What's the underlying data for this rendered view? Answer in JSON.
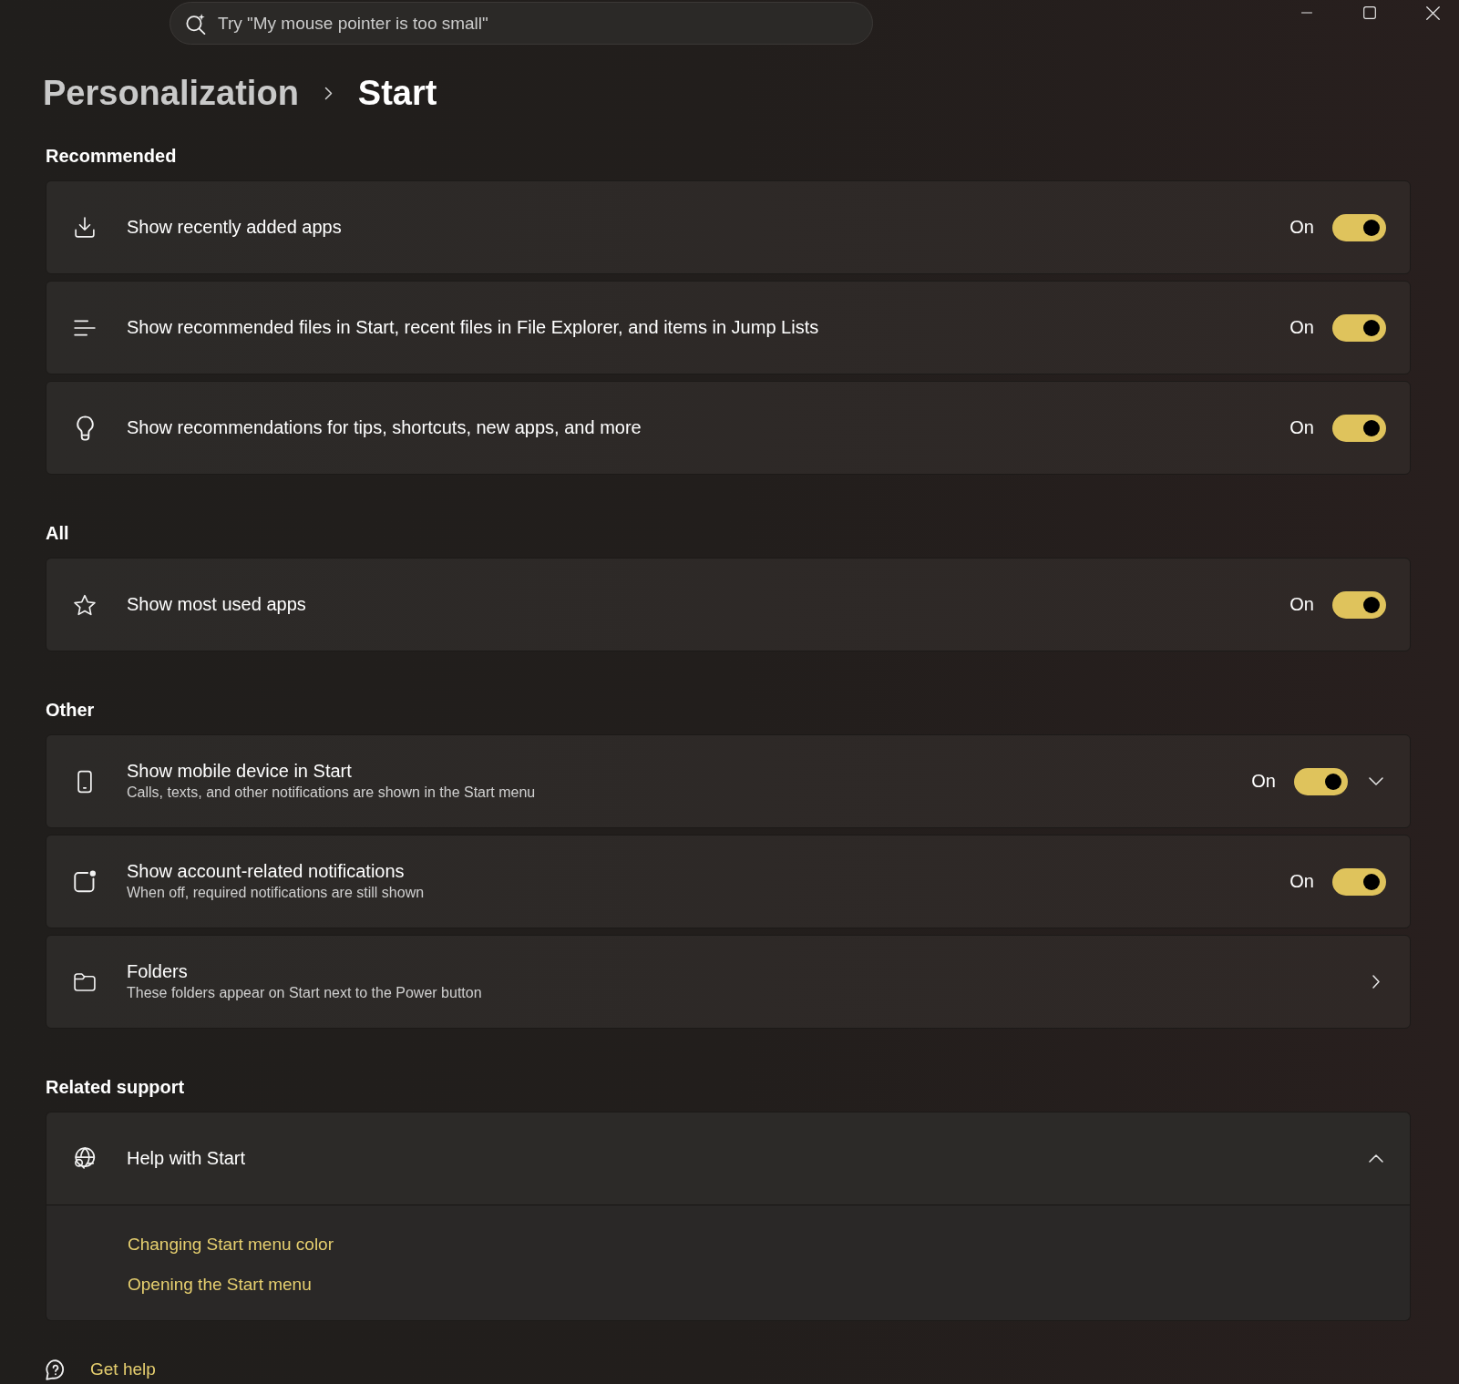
{
  "search": {
    "placeholder": "Try \"My mouse pointer is too small\""
  },
  "breadcrumb": [
    {
      "label": "Personalization",
      "selected": false
    },
    {
      "label": "Start",
      "selected": true
    }
  ],
  "sections": [
    {
      "heading": "Recommended",
      "items": [
        {
          "kind": "toggle",
          "title": "Show recently added apps",
          "state_label": "On",
          "on": true
        },
        {
          "kind": "toggle",
          "title": "Show recommended files in Start, recent files in File Explorer, and items in Jump Lists",
          "state_label": "On",
          "on": true
        },
        {
          "kind": "toggle",
          "title": "Show recommendations for tips, shortcuts, new apps, and more",
          "state_label": "On",
          "on": true
        }
      ]
    },
    {
      "heading": "All",
      "items": [
        {
          "kind": "toggle",
          "title": "Show most used apps",
          "state_label": "On",
          "on": true
        }
      ]
    },
    {
      "heading": "Other",
      "items": [
        {
          "kind": "toggle",
          "title": "Show mobile device in Start",
          "description": "Calls, texts, and other notifications are shown in the Start menu",
          "state_label": "On",
          "on": true,
          "expanded": false
        },
        {
          "kind": "toggle",
          "title": "Show account-related notifications",
          "description": "When off, required notifications are still shown",
          "state_label": "On",
          "on": true
        },
        {
          "kind": "link",
          "title": "Folders",
          "description": "These folders appear on Start next to the Power button"
        }
      ]
    },
    {
      "heading": "Related support",
      "items": [
        {
          "kind": "expander",
          "title": "Help with Start",
          "expanded": true,
          "links": [
            {
              "label": "Changing Start menu color"
            },
            {
              "label": "Opening the Start menu"
            }
          ]
        }
      ]
    }
  ],
  "get_help": {
    "label": "Get help"
  }
}
